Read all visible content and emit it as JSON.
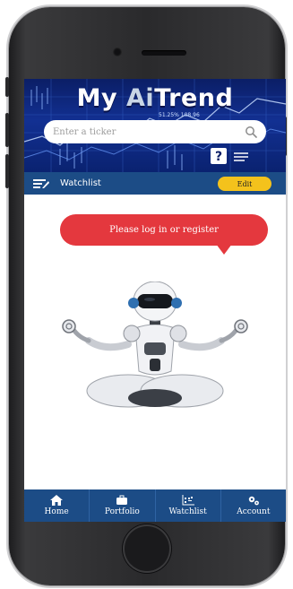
{
  "app": {
    "logo_my": "My",
    "logo_ai": "Ai",
    "logo_trend": "Trend",
    "banner_ticker_text": "51.25% 108.96"
  },
  "search": {
    "placeholder": "Enter a ticker",
    "icon": "search-icon"
  },
  "header_icons": {
    "help": "help-icon",
    "list": "list-icon"
  },
  "watchlist_bar": {
    "title": "Watchlist",
    "edit_label": "Edit",
    "icon": "watchlist-menu-icon"
  },
  "message": {
    "text": "Please log in or register"
  },
  "illustration": {
    "subject": "robot-meditating"
  },
  "bottom_nav": {
    "items": [
      {
        "label": "Home",
        "icon": "home-icon"
      },
      {
        "label": "Portfolio",
        "icon": "briefcase-icon"
      },
      {
        "label": "Watchlist",
        "icon": "chart-icon"
      },
      {
        "label": "Account",
        "icon": "gears-icon"
      }
    ]
  },
  "colors": {
    "banner": "#123092",
    "bar": "#1c4c86",
    "edit_button": "#f4c21c",
    "bubble": "#e4383e"
  }
}
